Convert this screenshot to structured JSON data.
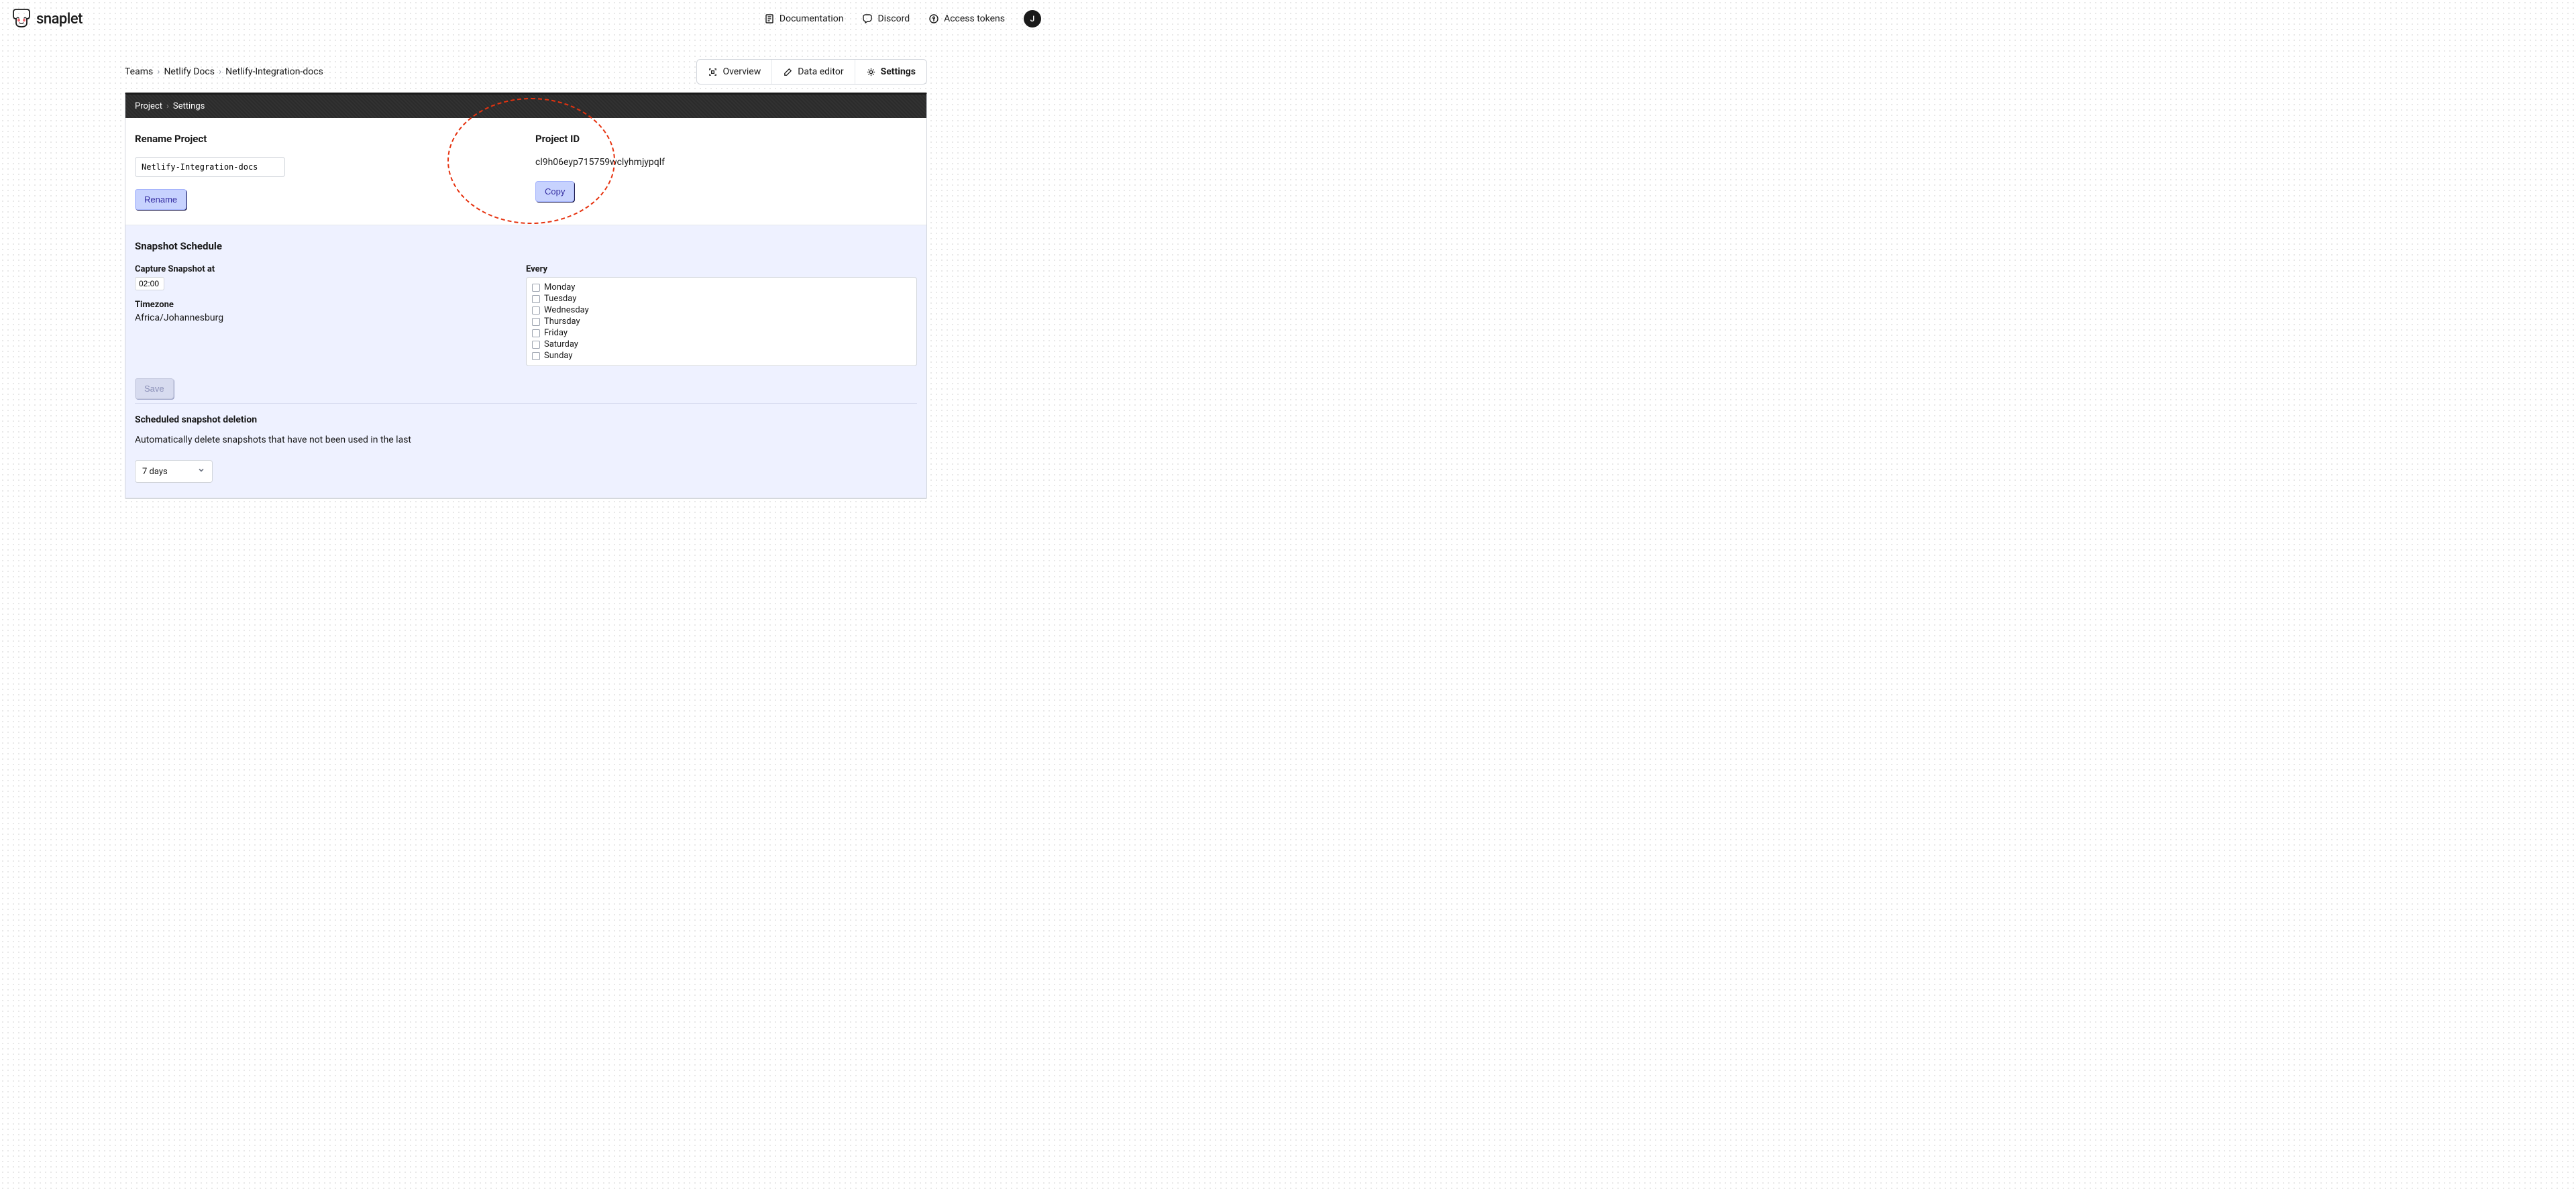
{
  "brand": {
    "name": "snaplet"
  },
  "header_nav": {
    "documentation": "Documentation",
    "discord": "Discord",
    "access_tokens": "Access tokens",
    "avatar_initial": "J"
  },
  "breadcrumb": {
    "teams": "Teams",
    "team": "Netlify Docs",
    "project": "Netlify-Integration-docs"
  },
  "tabs": {
    "overview": "Overview",
    "data_editor": "Data editor",
    "settings": "Settings"
  },
  "panel_crumb": {
    "project": "Project",
    "settings": "Settings"
  },
  "rename": {
    "title": "Rename Project",
    "value": "Netlify-Integration-docs",
    "button": "Rename"
  },
  "project_id": {
    "title": "Project ID",
    "value": "cl9h06eyp715759wclyhmjypqlf",
    "copy": "Copy"
  },
  "schedule": {
    "title": "Snapshot Schedule",
    "capture_label": "Capture Snapshot at",
    "capture_time": "02:00",
    "timezone_label": "Timezone",
    "timezone_value": "Africa/Johannesburg",
    "every_label": "Every",
    "days": [
      "Monday",
      "Tuesday",
      "Wednesday",
      "Thursday",
      "Friday",
      "Saturday",
      "Sunday"
    ],
    "save": "Save"
  },
  "deletion": {
    "title": "Scheduled snapshot deletion",
    "desc": "Automatically delete snapshots that have not been used in the last",
    "select_value": "7 days"
  }
}
